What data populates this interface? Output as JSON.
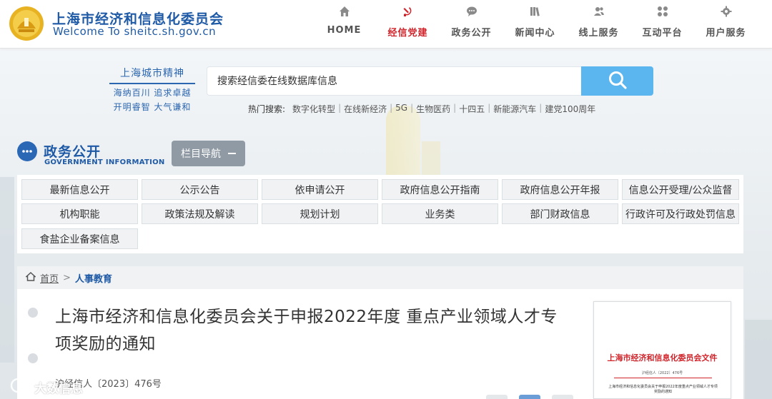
{
  "header": {
    "site_title": "上海市经济和信息化委员会",
    "site_domain": "Welcome  To  sheitc.sh.gov.cn",
    "nav": [
      {
        "label": "HOME",
        "icon": "home-icon",
        "active": false
      },
      {
        "label": "经信党建",
        "icon": "hammer-sickle-icon",
        "active": true
      },
      {
        "label": "政务公开",
        "icon": "chat-bubble-icon",
        "active": false
      },
      {
        "label": "新闻中心",
        "icon": "books-icon",
        "active": false
      },
      {
        "label": "线上服务",
        "icon": "users-icon",
        "active": false
      },
      {
        "label": "互动平台",
        "icon": "grid-dots-icon",
        "active": false
      },
      {
        "label": "用户服务",
        "icon": "settings-icon",
        "active": false
      }
    ]
  },
  "slogan": {
    "line1": "上海城市精神",
    "line2": "海纳百川 追求卓越",
    "line3": "开明睿智 大气谦和"
  },
  "search": {
    "placeholder": "搜索经信委在线数据库信息",
    "hot_label": "热门搜索:",
    "hot_keywords": [
      "数字化转型",
      "在线新经济",
      "5G",
      "生物医药",
      "十四五",
      "新能源汽车",
      "建党100周年"
    ]
  },
  "section": {
    "title": "政务公开",
    "subtitle": "GOVERNMENT INFORMATION",
    "column_nav_label": "栏目导航"
  },
  "categories": [
    "最新信息公开",
    "公示公告",
    "依申请公开",
    "政府信息公开指南",
    "政府信息公开年报",
    "信息公开受理/公众监督",
    "机构职能",
    "政策法规及解读",
    "规划计划",
    "业务类",
    "部门财政信息",
    "行政许可及行政处罚信息",
    "食盐企业备案信息"
  ],
  "breadcrumb": {
    "home": "首页",
    "separator": ">",
    "current": "人事教育"
  },
  "article": {
    "title": "上海市经济和信息化委员会关于申报2022年度 重点产业领域人才专项奖励的通知",
    "doc_number": "沪经信人〔2023〕476号",
    "thumbnail": {
      "header": "上海市经济和信息化委员会文件",
      "doc_no": "沪经信人〔2022〕476号",
      "body": "上海市经济和信息化委员会关于申报2022年度重点产业领域人才专项奖励的通知"
    }
  },
  "watermark": "大数信息",
  "colors": {
    "brand_blue": "#1f5aa6",
    "active_red": "#d0242b",
    "search_button": "#5bb5ef",
    "column_nav_button": "#8f9aa4"
  }
}
